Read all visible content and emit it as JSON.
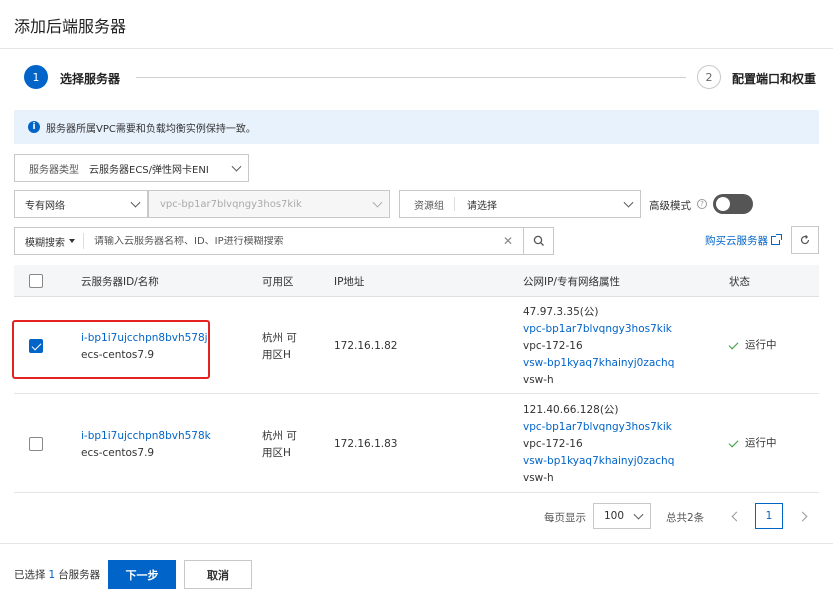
{
  "dialog": {
    "title": "添加后端服务器"
  },
  "steps": [
    {
      "number": "1",
      "label": "选择服务器"
    },
    {
      "number": "2",
      "label": "配置端口和权重"
    }
  ],
  "notice": {
    "text": "服务器所属VPC需要和负载均衡实例保持一致。"
  },
  "filters": {
    "server_type_label": "服务器类型",
    "server_type_value": "云服务器ECS/弹性网卡ENI",
    "network_value": "专有网络",
    "vpc_value": "vpc-bp1ar7blvqngy3hos7kik",
    "resource_group_label": "资源组",
    "resource_group_value": "请选择",
    "advanced_mode_label": "高级模式",
    "search_mode": "模糊搜索",
    "search_placeholder": "请输入云服务器名称、ID、IP进行模糊搜索",
    "buy_link": "购买云服务器"
  },
  "table": {
    "headers": [
      "云服务器ID/名称",
      "可用区",
      "IP地址",
      "公网IP/专有网络属性",
      "状态"
    ],
    "rows": [
      {
        "checked": true,
        "id": "i-bp1i7ujcchpn8bvh578j",
        "name": "ecs-centos7.9",
        "zone_line1": "杭州 可",
        "zone_line2": "用区H",
        "ip": "172.16.1.82",
        "public_ip": "47.97.3.35(公)",
        "vpc_id": "vpc-bp1ar7blvqngy3hos7kik",
        "vpc_name": "vpc-172-16",
        "vsw_id": "vsw-bp1kyaq7khainyj0zachq",
        "vsw_name": "vsw-h",
        "status": "运行中"
      },
      {
        "checked": false,
        "id": "i-bp1i7ujcchpn8bvh578k",
        "name": "ecs-centos7.9",
        "zone_line1": "杭州 可",
        "zone_line2": "用区H",
        "ip": "172.16.1.83",
        "public_ip": "121.40.66.128(公)",
        "vpc_id": "vpc-bp1ar7blvqngy3hos7kik",
        "vpc_name": "vpc-172-16",
        "vsw_id": "vsw-bp1kyaq7khainyj0zachq",
        "vsw_name": "vsw-h",
        "status": "运行中"
      }
    ]
  },
  "pagination": {
    "per_page_label": "每页显示",
    "per_page_value": "100",
    "total": "总共2条",
    "current_page": "1"
  },
  "footer": {
    "selected_prefix": "已选择",
    "selected_count": "1",
    "selected_suffix": "台服务器",
    "next_label": "下一步",
    "cancel_label": "取消"
  },
  "colors": {
    "primary": "#0064c8",
    "highlight": "#e52222",
    "success": "#2e9d3a"
  },
  "icons": [
    "info-icon",
    "help-icon",
    "chevron-down-icon",
    "clear-icon",
    "search-icon",
    "external-link-icon",
    "refresh-icon",
    "check-icon"
  ]
}
